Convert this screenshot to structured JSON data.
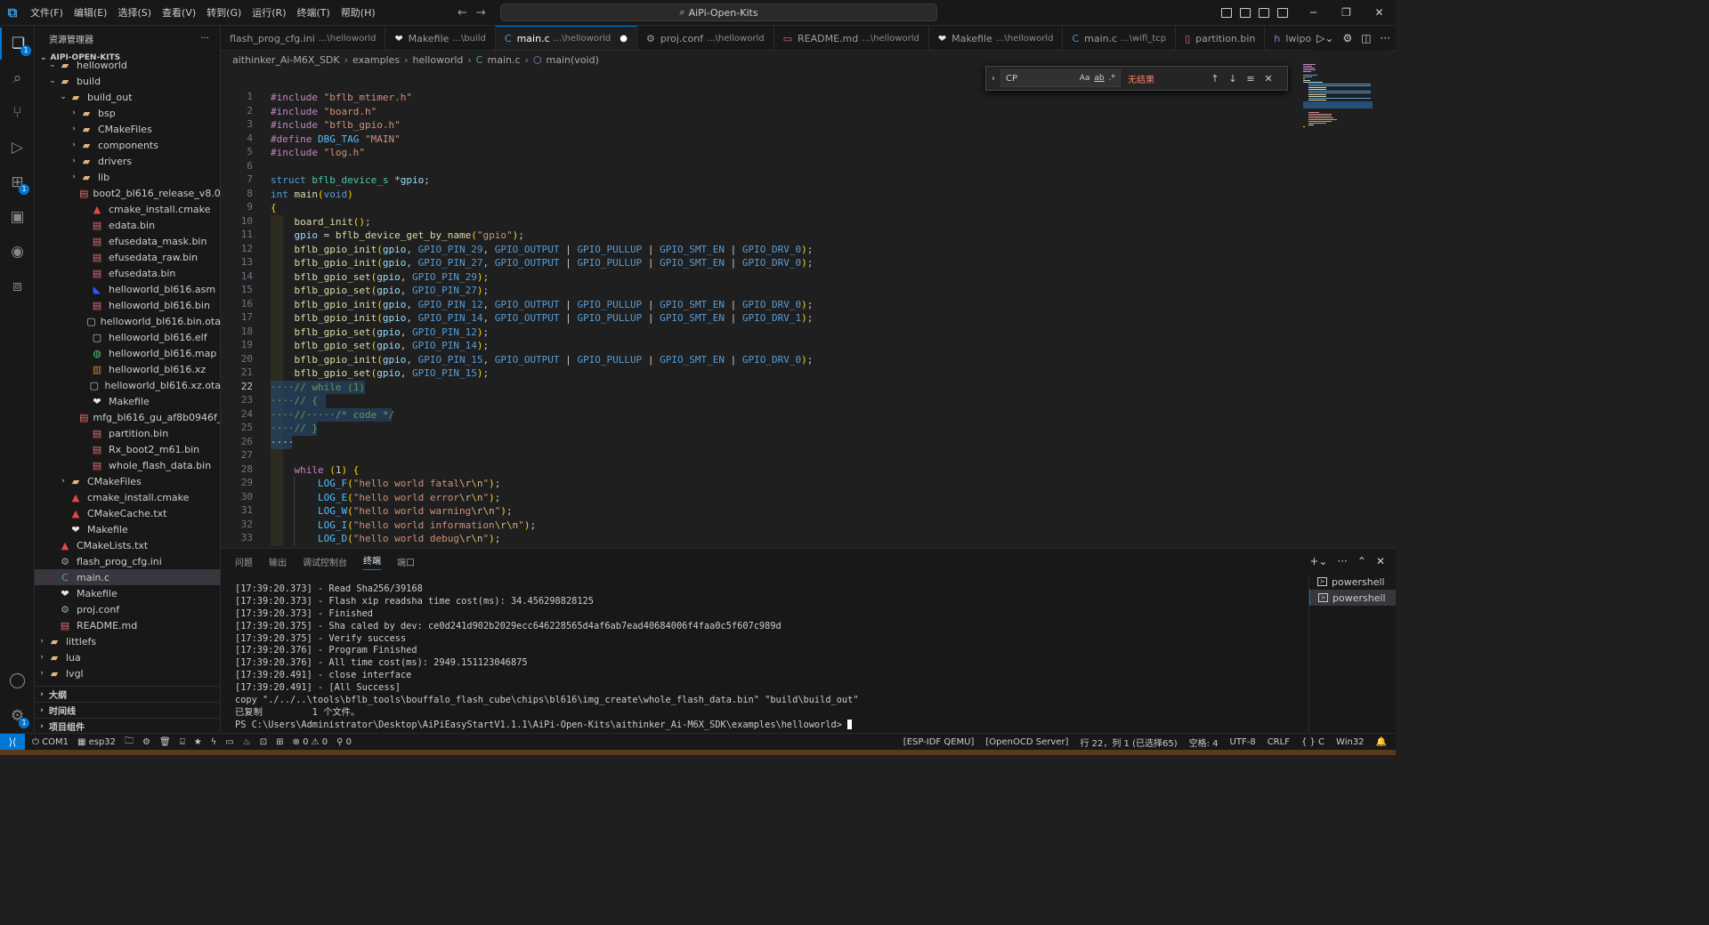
{
  "titlebar": {
    "menu": [
      "文件(F)",
      "编辑(E)",
      "选择(S)",
      "查看(V)",
      "转到(G)",
      "运行(R)",
      "终端(T)",
      "帮助(H)"
    ],
    "search": "AiPi-Open-Kits"
  },
  "activity": {
    "explorer_badge": "1",
    "extensions_badge": "1",
    "settings_badge": "1"
  },
  "sidebar": {
    "title": "资源管理器",
    "more": "···",
    "root": "AIPI-OPEN-KITS",
    "items": [
      {
        "label": "helloworld",
        "icon": "folder-icon",
        "chev": "⌄"
      },
      {
        "label": "build",
        "icon": "folder-icon",
        "chev": "⌄"
      },
      {
        "label": "build_out",
        "icon": "folder-icon",
        "chev": "⌄"
      },
      {
        "label": "bsp",
        "icon": "folder-icon",
        "chev": "›"
      },
      {
        "label": "CMakeFiles",
        "icon": "folder-icon",
        "chev": "›"
      },
      {
        "label": "components",
        "icon": "folder-icon",
        "chev": "›"
      },
      {
        "label": "drivers",
        "icon": "folder-icon",
        "chev": "›"
      },
      {
        "label": "lib",
        "icon": "folder-icon",
        "chev": "›"
      },
      {
        "label": "boot2_bl616_release_v8.0...",
        "icon": "bin-icon",
        "chev": ""
      },
      {
        "label": "cmake_install.cmake",
        "icon": "cmake-icon",
        "chev": ""
      },
      {
        "label": "edata.bin",
        "icon": "bin-icon",
        "chev": ""
      },
      {
        "label": "efusedata_mask.bin",
        "icon": "bin-icon",
        "chev": ""
      },
      {
        "label": "efusedata_raw.bin",
        "icon": "bin-icon",
        "chev": ""
      },
      {
        "label": "efusedata.bin",
        "icon": "bin-icon",
        "chev": ""
      },
      {
        "label": "helloworld_bl616.asm",
        "icon": "asm-icon",
        "chev": ""
      },
      {
        "label": "helloworld_bl616.bin",
        "icon": "bin-icon",
        "chev": ""
      },
      {
        "label": "helloworld_bl616.bin.ota",
        "icon": "file-icon",
        "chev": ""
      },
      {
        "label": "helloworld_bl616.elf",
        "icon": "file-icon",
        "chev": ""
      },
      {
        "label": "helloworld_bl616.map",
        "icon": "map-icon",
        "chev": ""
      },
      {
        "label": "helloworld_bl616.xz",
        "icon": "xz-icon",
        "chev": ""
      },
      {
        "label": "helloworld_bl616.xz.ota",
        "icon": "file-icon",
        "chev": ""
      },
      {
        "label": "Makefile",
        "icon": "make-icon",
        "chev": ""
      },
      {
        "label": "mfg_bl616_gu_af8b0946f_...",
        "icon": "bin-icon",
        "chev": ""
      },
      {
        "label": "partition.bin",
        "icon": "bin-icon",
        "chev": ""
      },
      {
        "label": "Rx_boot2_m61.bin",
        "icon": "bin-icon",
        "chev": ""
      },
      {
        "label": "whole_flash_data.bin",
        "icon": "bin-icon",
        "chev": ""
      },
      {
        "label": "CMakeFiles",
        "icon": "folder-icon",
        "chev": "›"
      },
      {
        "label": "cmake_install.cmake",
        "icon": "cmake-icon",
        "chev": ""
      },
      {
        "label": "CMakeCache.txt",
        "icon": "cmake-icon",
        "chev": ""
      },
      {
        "label": "Makefile",
        "icon": "make-icon",
        "chev": ""
      },
      {
        "label": "CMakeLists.txt",
        "icon": "cmake-icon",
        "chev": ""
      },
      {
        "label": "flash_prog_cfg.ini",
        "icon": "gear-file-icon",
        "chev": ""
      },
      {
        "label": "main.c",
        "icon": "c-icon",
        "chev": ""
      },
      {
        "label": "Makefile",
        "icon": "make-icon",
        "chev": ""
      },
      {
        "label": "proj.conf",
        "icon": "gear-file-icon",
        "chev": ""
      },
      {
        "label": "README.md",
        "icon": "bin-icon",
        "chev": ""
      },
      {
        "label": "littlefs",
        "icon": "folder-icon",
        "chev": "›"
      },
      {
        "label": "lua",
        "icon": "folder-icon",
        "chev": "›"
      },
      {
        "label": "lvgl",
        "icon": "folder-icon",
        "chev": "›"
      }
    ],
    "sections": [
      "大纲",
      "时间线",
      "项目组件"
    ]
  },
  "tabs": [
    {
      "name": "flash_prog_cfg.ini",
      "desc": "...\\helloworld",
      "icon": "",
      "active": false
    },
    {
      "name": "Makefile",
      "desc": "...\\build",
      "icon": "❤",
      "active": false
    },
    {
      "name": "main.c",
      "desc": "...\\helloworld",
      "icon": "C",
      "active": true,
      "dirty": "●"
    },
    {
      "name": "proj.conf",
      "desc": "...\\helloworld",
      "icon": "⚙",
      "active": false
    },
    {
      "name": "README.md",
      "desc": "...\\helloworld",
      "icon": "▭",
      "active": false
    },
    {
      "name": "Makefile",
      "desc": "...\\helloworld",
      "icon": "❤",
      "active": false
    },
    {
      "name": "main.c",
      "desc": "...\\wifi_tcp",
      "icon": "C",
      "active": false
    },
    {
      "name": "partition.bin",
      "desc": "",
      "icon": "▯",
      "active": false
    },
    {
      "name": "lwipopts_us",
      "desc": "",
      "icon": "h",
      "active": false
    }
  ],
  "breadcrumb": [
    "aithinker_Ai-M6X_SDK",
    "examples",
    "helloworld",
    "main.c",
    "main(void)"
  ],
  "find": {
    "value": "CP",
    "opt_case": "Aa",
    "opt_word": "ab",
    "opt_regex": ".*",
    "result": "无结果"
  },
  "editor": {
    "current_line": 22,
    "line_numbers": [
      "1",
      "2",
      "3",
      "4",
      "5",
      "6",
      "7",
      "8",
      "9",
      "10",
      "11",
      "12",
      "13",
      "14",
      "15",
      "16",
      "17",
      "18",
      "19",
      "20",
      "21",
      "22",
      "23",
      "24",
      "25",
      "26",
      "27",
      "28",
      "29",
      "30",
      "31",
      "32",
      "33"
    ],
    "code": [
      "#include \"bflb_mtimer.h\"",
      "#include \"board.h\"",
      "#include \"bflb_gpio.h\"",
      "#define DBG_TAG \"MAIN\"",
      "#include \"log.h\"",
      "",
      "struct bflb_device_s *gpio;",
      "int main(void)",
      "{",
      "    board_init();",
      "    gpio = bflb_device_get_by_name(\"gpio\");",
      "    bflb_gpio_init(gpio, GPIO_PIN_29, GPIO_OUTPUT | GPIO_PULLUP | GPIO_SMT_EN | GPIO_DRV_0);",
      "    bflb_gpio_init(gpio, GPIO_PIN_27, GPIO_OUTPUT | GPIO_PULLUP | GPIO_SMT_EN | GPIO_DRV_0);",
      "    bflb_gpio_set(gpio, GPIO_PIN_29);",
      "    bflb_gpio_set(gpio, GPIO_PIN_27);",
      "    bflb_gpio_init(gpio, GPIO_PIN_12, GPIO_OUTPUT | GPIO_PULLUP | GPIO_SMT_EN | GPIO_DRV_0);",
      "    bflb_gpio_init(gpio, GPIO_PIN_14, GPIO_OUTPUT | GPIO_PULLUP | GPIO_SMT_EN | GPIO_DRV_1);",
      "    bflb_gpio_set(gpio, GPIO_PIN_12);",
      "    bflb_gpio_set(gpio, GPIO_PIN_14);",
      "    bflb_gpio_init(gpio, GPIO_PIN_15, GPIO_OUTPUT | GPIO_PULLUP | GPIO_SMT_EN | GPIO_DRV_0);",
      "    bflb_gpio_set(gpio, GPIO_PIN_15);",
      "····// while (1)",
      "····// {",
      "····//·····/* code */",
      "····// }",
      "····",
      "",
      "    while (1) {",
      "        LOG_F(\"hello world fatal\\r\\n\");",
      "        LOG_E(\"hello world error\\r\\n\");",
      "        LOG_W(\"hello world warning\\r\\n\");",
      "        LOG_I(\"hello world information\\r\\n\");",
      "        LOG_D(\"hello world debug\\r\\n\");"
    ]
  },
  "panel": {
    "tabs": [
      "问题",
      "输出",
      "调试控制台",
      "终端",
      "端口"
    ],
    "active_tab": "终端",
    "terminal_lines": [
      "[17:39:20.373] - Read Sha256/39168",
      "[17:39:20.373] - Flash xip readsha time cost(ms): 34.456298828125",
      "[17:39:20.373] - Finished",
      "[17:39:20.375] - Sha caled by dev: ce0d241d902b2029ecc646228565d4af6ab7ead40684006f4faa0c5f607c989d",
      "[17:39:20.375] - Verify success",
      "[17:39:20.376] - Program Finished",
      "[17:39:20.376] - All time cost(ms): 2949.151123046875",
      "[17:39:20.491] - close interface",
      "[17:39:20.491] - [All Success]",
      "copy \"./../..\\tools\\bflb_tools\\bouffalo_flash_cube\\chips\\bl616\\img_create\\whole_flash_data.bin\" \"build\\build_out\"",
      "已复制         1 个文件。",
      "PS C:\\Users\\Administrator\\Desktop\\AiPiEasyStartV1.1.1\\AiPi-Open-Kits\\aithinker_Ai-M6X_SDK\\examples\\helloworld> "
    ],
    "terminals": [
      "powershell",
      "powershell"
    ]
  },
  "statusbar": {
    "com": "COM1",
    "target": "esp32",
    "errors": "0",
    "warnings": "0",
    "ports": "0",
    "idf_qemu": "[ESP-IDF QEMU]",
    "openocd": "[OpenOCD Server]",
    "position": "行 22，列 1 (已选择65)",
    "spaces": "空格: 4",
    "encoding": "UTF-8",
    "eol": "CRLF",
    "language": "{ } C",
    "platform": "Win32"
  },
  "colors": {
    "accent": "#0078d4",
    "background": "#1f1f1f",
    "sidebar": "#181818",
    "find_no_result": "#f48771"
  }
}
